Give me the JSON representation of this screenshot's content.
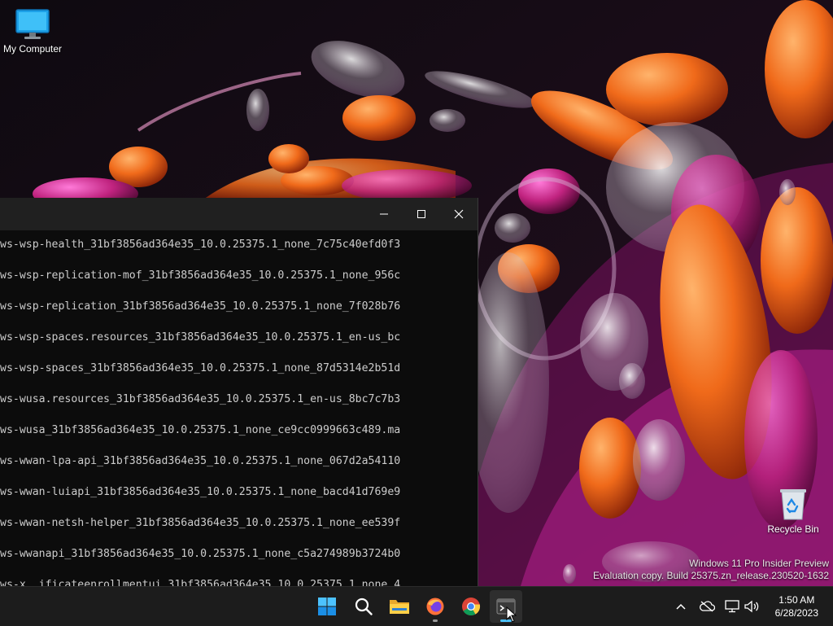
{
  "desktop": {
    "icons": [
      {
        "label": "My Computer",
        "icon": "computer-icon"
      },
      {
        "label": "Recycle Bin",
        "icon": "recycle-bin-icon"
      }
    ],
    "watermark": {
      "line1": "Windows 11 Pro Insider Preview",
      "line2": "Evaluation copy. Build 25375.zn_release.230520-1632"
    }
  },
  "terminal": {
    "controls": {
      "minimize": "minimize-icon",
      "maximize": "maximize-icon",
      "close": "close-icon"
    },
    "lines": [
      "ws-wsp-health_31bf3856ad364e35_10.0.25375.1_none_7c75c40efd0f3",
      "ws-wsp-replication-mof_31bf3856ad364e35_10.0.25375.1_none_956c",
      "ws-wsp-replication_31bf3856ad364e35_10.0.25375.1_none_7f028b76",
      "ws-wsp-spaces.resources_31bf3856ad364e35_10.0.25375.1_en-us_bc",
      "ws-wsp-spaces_31bf3856ad364e35_10.0.25375.1_none_87d5314e2b51d",
      "ws-wusa.resources_31bf3856ad364e35_10.0.25375.1_en-us_8bc7c7b3",
      "ws-wusa_31bf3856ad364e35_10.0.25375.1_none_ce9cc0999663c489.ma",
      "ws-wwan-lpa-api_31bf3856ad364e35_10.0.25375.1_none_067d2a54110",
      "ws-wwan-luiapi_31bf3856ad364e35_10.0.25375.1_none_bacd41d769e9",
      "ws-wwan-netsh-helper_31bf3856ad364e35_10.0.25375.1_none_ee539f",
      "ws-wwanapi_31bf3856ad364e35_10.0.25375.1_none_c5a274989b3724b0",
      "ws-x..ificateenrollmentui_31bf3856ad364e35_10.0.25375.1_none_4"
    ]
  },
  "taskbar": {
    "apps": [
      {
        "name": "start",
        "icon": "windows-start-icon"
      },
      {
        "name": "search",
        "icon": "search-icon"
      },
      {
        "name": "file-explorer",
        "icon": "folder-icon"
      },
      {
        "name": "firefox",
        "icon": "firefox-icon"
      },
      {
        "name": "chrome",
        "icon": "chrome-icon"
      },
      {
        "name": "terminal",
        "icon": "terminal-icon"
      }
    ],
    "tray": [
      "chevron-up-icon",
      "cloud-offline-icon",
      "network-icon",
      "volume-icon"
    ],
    "clock": {
      "time": "1:50 AM",
      "date": "6/28/2023"
    }
  },
  "colors": {
    "taskbar": "#1c1c1c",
    "terminal_bg": "#0c0c0c",
    "titlebar": "#202020",
    "accent": "#0078d4"
  }
}
